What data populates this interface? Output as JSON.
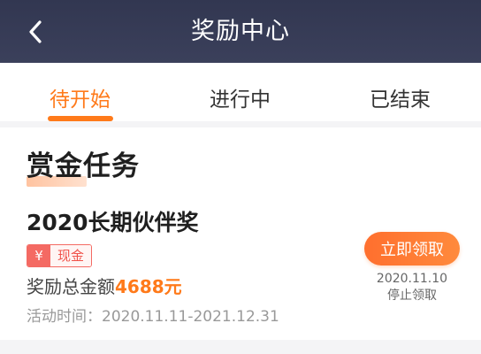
{
  "header": {
    "title": "奖励中心",
    "back_icon": "chevron-left-icon"
  },
  "tabs": [
    {
      "label": "待开始",
      "active": true
    },
    {
      "label": "进行中",
      "active": false
    },
    {
      "label": "已结束",
      "active": false
    }
  ],
  "section": {
    "title": "赏金任务"
  },
  "reward": {
    "name": "2020长期伙伴奖",
    "tag_icon": "¥",
    "tag_label": "现金",
    "total_label": "奖励总金额",
    "total_amount": "4688元",
    "period_label": "活动时间：",
    "period_value": "2020.11.11-2021.12.31",
    "claim_label": "立即领取",
    "deadline_date": "2020.11.10",
    "deadline_text": "停止领取"
  },
  "colors": {
    "header_bg": "#343952",
    "accent": "#ff7a1a",
    "tag_red": "#f46a63"
  }
}
